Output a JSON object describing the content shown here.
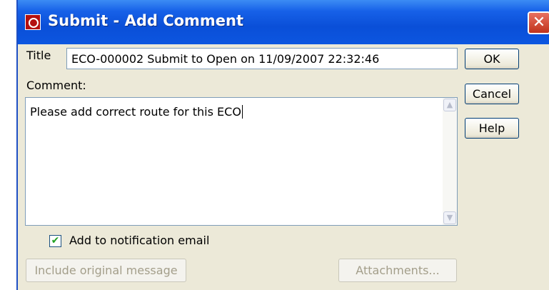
{
  "window": {
    "title": "Submit - Add Comment",
    "close_glyph": "✕"
  },
  "form": {
    "title_label": "Title",
    "title_value": "ECO-000002 Submit to Open on 11/09/2007 22:32:46",
    "comment_label": "Comment:",
    "comment_value": "Please add correct route for this ECO",
    "notify_label": "Add to notification email",
    "notify_checked": true,
    "check_glyph": "✔"
  },
  "buttons": {
    "ok": "OK",
    "cancel": "Cancel",
    "help": "Help",
    "include_original": "Include original message",
    "attachments": "Attachments..."
  },
  "scroll": {
    "up_glyph": "▲",
    "down_glyph": "▼"
  },
  "colors": {
    "titlebar": "#0a4fd8",
    "dialog_bg": "#ece9d8",
    "close": "#c0331c",
    "check": "#21a121"
  }
}
